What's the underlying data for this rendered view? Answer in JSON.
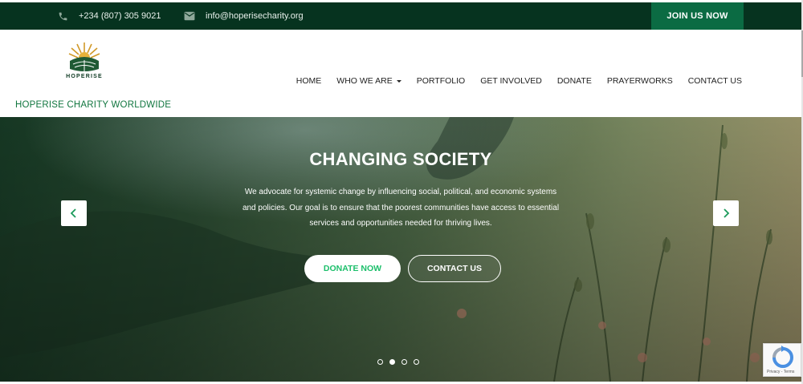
{
  "topbar": {
    "phone": "+234 (807) 305 9021",
    "email": "info@hoperisecharity.org",
    "join_label": "JOIN US NOW",
    "phone_icon": "phone-icon",
    "email_icon": "envelope-icon"
  },
  "header": {
    "logo_text": "HOPERISE",
    "tagline": "HOPERISE CHARITY WORLDWIDE",
    "nav": [
      {
        "label": "HOME"
      },
      {
        "label": "WHO WE ARE"
      },
      {
        "label": "PORTFOLIO"
      },
      {
        "label": "GET INVOLVED"
      },
      {
        "label": "DONATE"
      },
      {
        "label": "PRAYERWORKS"
      },
      {
        "label": "CONTACT US"
      }
    ]
  },
  "hero": {
    "title": "CHANGING SOCIETY",
    "text": "We advocate for systemic change by influencing social, political, and economic systems and policies. Our goal is to ensure that the poorest communities have access to essential services and opportunities needed for thriving lives.",
    "donate_label": "DONATE NOW",
    "contact_label": "CONTACT US",
    "prev_icon": "chevron-left-icon",
    "next_icon": "chevron-right-icon",
    "slides": 4,
    "active_slide": 2
  },
  "recaptcha": {
    "footer": "Privacy - Terms"
  },
  "colors": {
    "topbar_bg": "#06331f",
    "join_bg": "#0b6b43",
    "tagline": "#11763f",
    "donate_text": "#1cbf6b"
  }
}
